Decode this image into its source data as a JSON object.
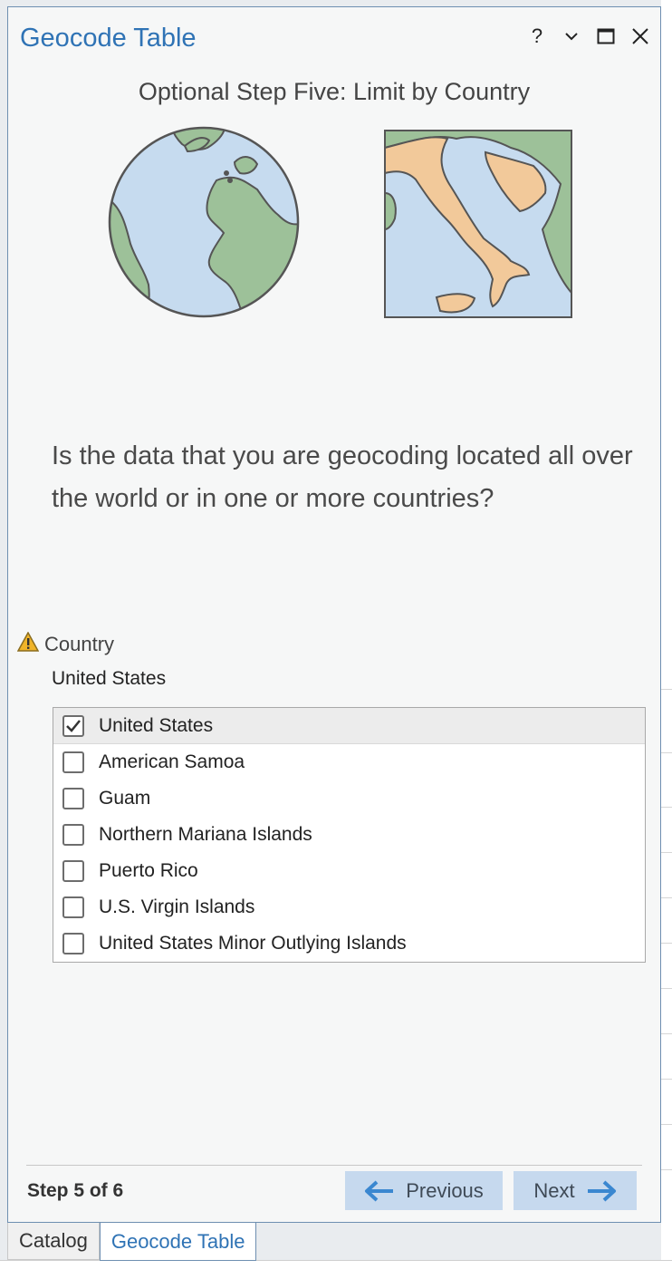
{
  "window": {
    "title": "Geocode Table",
    "buttons": {
      "help": "?",
      "menu": "⌄",
      "maximize": "□",
      "close": "✕"
    }
  },
  "wizard": {
    "heading": "Optional Step Five: Limit by Country",
    "question": "Is the data that you are geocoding located all over the world or in one or more countries?",
    "country_label": "Country",
    "country_value": "United States",
    "countries": [
      {
        "label": "United States",
        "checked": true
      },
      {
        "label": "American Samoa",
        "checked": false
      },
      {
        "label": "Guam",
        "checked": false
      },
      {
        "label": "Northern Mariana Islands",
        "checked": false
      },
      {
        "label": "Puerto Rico",
        "checked": false
      },
      {
        "label": "U.S. Virgin Islands",
        "checked": false
      },
      {
        "label": "United States Minor Outlying Islands",
        "checked": false
      }
    ],
    "step_indicator": "Step 5 of 6",
    "previous_label": "Previous",
    "next_label": "Next"
  },
  "tabs": [
    {
      "label": "Catalog",
      "active": false
    },
    {
      "label": "Geocode Table",
      "active": true
    }
  ],
  "colors": {
    "accent": "#2f73b5",
    "button_bg": "#c6d9ee",
    "arrow": "#3a87d0",
    "warning": "#f0b429"
  },
  "icons": [
    "help-icon",
    "chevron-down-icon",
    "maximize-icon",
    "close-icon",
    "globe-illustration",
    "country-map-illustration",
    "warning-icon",
    "checkmark-icon",
    "arrow-left-icon",
    "arrow-right-icon"
  ]
}
